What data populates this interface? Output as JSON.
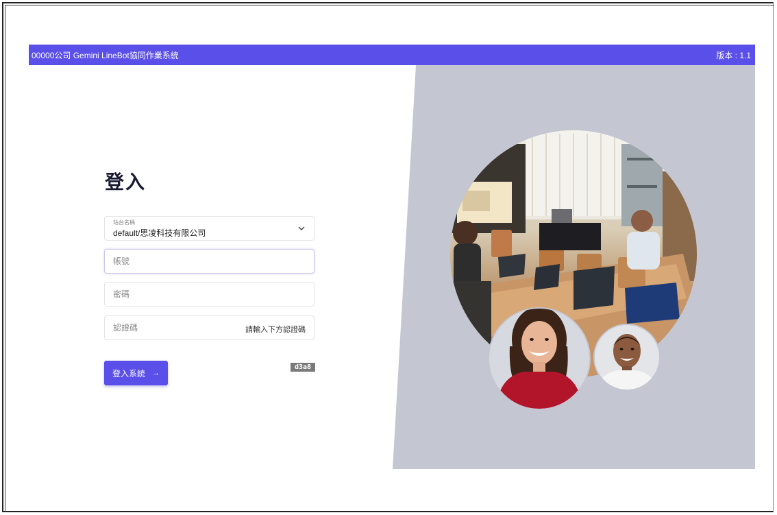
{
  "header": {
    "title": "00000公司 Gemini LineBot協同作業系統",
    "version": "版本 : 1.1"
  },
  "login": {
    "heading": "登入",
    "site": {
      "label": "站台名稱",
      "value": "default/思凌科技有限公司"
    },
    "account": {
      "placeholder": "帳號"
    },
    "password": {
      "placeholder": "密碼"
    },
    "captcha": {
      "placeholder": "認證碼",
      "hint": "請輸入下方認證碼",
      "code": "d3a8"
    },
    "submit_label": "登入系統",
    "submit_arrow": "→"
  },
  "colors": {
    "accent": "#5b4fe9",
    "panel": "#c4c6d2"
  },
  "icons": {
    "select_chevron": "chevron-down-icon",
    "submit_arrow": "arrow-right-icon"
  }
}
